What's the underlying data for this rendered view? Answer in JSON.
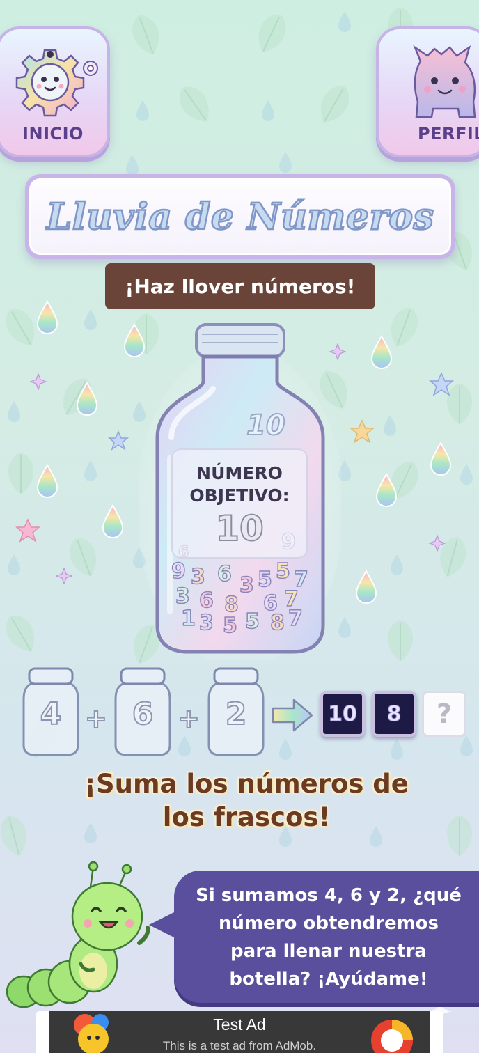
{
  "header": {
    "home_button": {
      "label": "INICIO",
      "icon": "gear-face-icon"
    },
    "profile_button": {
      "label": "PERFIL",
      "icon": "monster-avatar-icon"
    }
  },
  "game": {
    "title": "Lluvia de Números",
    "subtitle": "¡Haz llover números!",
    "bottle": {
      "top_number": "10",
      "target_title_line1": "NÚMERO",
      "target_title_line2": "OBJETIVO:",
      "target_value": "10"
    },
    "equation": {
      "jars": [
        "4",
        "6",
        "2"
      ],
      "operator": "+",
      "answer_options": [
        "10",
        "8",
        "?"
      ]
    },
    "instruction_line1": "¡Suma los números de",
    "instruction_line2": "los frascos!",
    "mascot": {
      "icon": "caterpillar-icon",
      "speech_line1": "Si sumamos 4, 6 y 2, ¿qué",
      "speech_line2": "número obtendremos",
      "speech_line3": "para llenar nuestra",
      "speech_line4": "botella? ¡Ayúdame!"
    }
  },
  "ad": {
    "title": "Test Ad",
    "subtitle": "This is a test ad from AdMob."
  },
  "colors": {
    "background_top": "#cfeee2",
    "bubble": "#5a4f9c",
    "subtitle_bg": "#6a4438",
    "answer_tile": "#1e1a46",
    "instruction_text": "#6a3a22"
  }
}
